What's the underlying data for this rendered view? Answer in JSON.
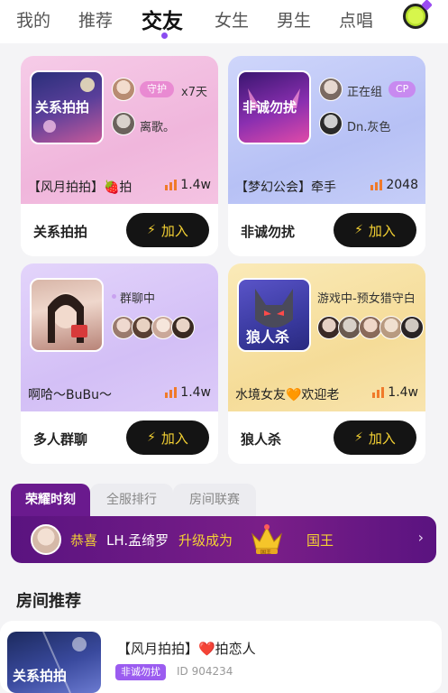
{
  "nav": {
    "tabs": [
      {
        "label": "我的"
      },
      {
        "label": "推荐"
      },
      {
        "label": "交友",
        "active": true
      },
      {
        "label": "女生"
      },
      {
        "label": "男生"
      },
      {
        "label": "点唱"
      }
    ]
  },
  "cards": [
    {
      "cover_text": "关系拍拍",
      "member1_badge": "守护",
      "member1_duration": "x7天",
      "member2_name": "离歌。",
      "room_name": "【风月拍拍】🍓拍",
      "heat": "1.4w",
      "room_type": "关系拍拍",
      "join_label": "加入"
    },
    {
      "cover_text": "非诚勿扰",
      "member1_status": "正在组",
      "member1_badge": "CP",
      "member2_name": "Dn.灰色",
      "room_name": "【梦幻公会】牵手",
      "heat": "2048",
      "room_type": "非诚勿扰",
      "join_label": "加入"
    },
    {
      "status": "群聊中",
      "room_name": "啊哈～BuBu～",
      "heat": "1.4w",
      "room_type": "多人群聊",
      "join_label": "加入"
    },
    {
      "cover_text": "狼人杀",
      "status": "游戏中-预女猎守白",
      "room_name": "水境女友🧡欢迎老",
      "heat": "1.4w",
      "room_type": "狼人杀",
      "join_label": "加入"
    }
  ],
  "honor": {
    "tabs": [
      "荣耀时刻",
      "全服排行",
      "房间联赛"
    ],
    "congrats": "恭喜",
    "user": "LH.孟绮罗",
    "action": "升级成为",
    "crown_label": "国王",
    "rank": "国王"
  },
  "section_title": "房间推荐",
  "recommend": {
    "cover_text": "关系拍拍",
    "title": "【风月拍拍】❤️拍恋人",
    "tag": "非诚勿扰",
    "id": "ID 904234"
  },
  "colors": {
    "accent": "#8a4cf0",
    "join_bg": "#141414",
    "join_text": "#f5d233",
    "heat_icon": "#f07a2a"
  }
}
